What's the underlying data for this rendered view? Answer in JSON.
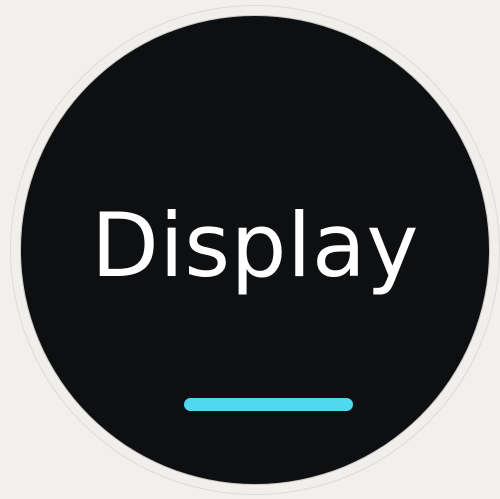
{
  "screen": {
    "title": "Display"
  },
  "colors": {
    "background": "#f2efed",
    "screen": "#0e0f10",
    "text": "#ffffff",
    "accent": "#4fd8ee"
  }
}
